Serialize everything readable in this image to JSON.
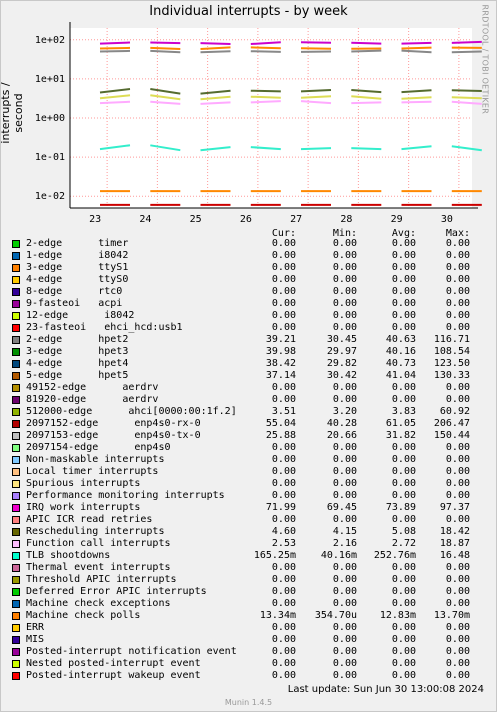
{
  "chart_data": {
    "type": "line",
    "title": "Individual interrupts - by week",
    "ylabel": "interrupts / second",
    "side_label": "RRDTOOL / TOBI OETIKER",
    "y_scale": "log",
    "ylim": [
      0.005,
      200
    ],
    "y_ticks": [
      "1e+02",
      "1e+01",
      "1e+00",
      "1e-01",
      "1e-02"
    ],
    "x_ticks": [
      "23",
      "24",
      "25",
      "26",
      "27",
      "28",
      "29",
      "30"
    ],
    "grid": true,
    "series": [
      {
        "name": "Performance monitoring interrupts / hpet",
        "color": "#cc00cc",
        "values": [
          80,
          85,
          82,
          78,
          86,
          84,
          80,
          83,
          88,
          82,
          79,
          81
        ]
      },
      {
        "name": "hpet5",
        "color": "#ff8800",
        "values": [
          60,
          62,
          58,
          64,
          61,
          59,
          60,
          63,
          62,
          58,
          61,
          60
        ]
      },
      {
        "name": "hpet4",
        "color": "#888888",
        "values": [
          50,
          52,
          48,
          51,
          49,
          50,
          53,
          48,
          50,
          51,
          49,
          52
        ]
      },
      {
        "name": "2097152-edge enp4s0-rx-0",
        "color": "#556b2f",
        "values": [
          4.5,
          5.5,
          4.2,
          5.0,
          4.8,
          5.2,
          4.6,
          5.1,
          4.9,
          5.3,
          4.7,
          4.5
        ]
      },
      {
        "name": "Rescheduling interrupts",
        "color": "#dddd55",
        "values": [
          3.2,
          3.8,
          3.0,
          3.5,
          3.3,
          3.6,
          3.1,
          3.4,
          3.2,
          3.7,
          3.0,
          3.3
        ]
      },
      {
        "name": "Function call interrupts",
        "color": "#ffaaff",
        "values": [
          2.4,
          2.6,
          2.3,
          2.5,
          2.7,
          2.4,
          2.5,
          2.6,
          2.3,
          2.5,
          2.4,
          2.6
        ]
      },
      {
        "name": "TLB shootdowns",
        "color": "#33eecc",
        "values": [
          0.16,
          0.2,
          0.15,
          0.18,
          0.16,
          0.17,
          0.16,
          0.19,
          0.15,
          0.17,
          0.16,
          0.18
        ]
      },
      {
        "name": "Machine check polls",
        "color": "#ff8800",
        "values": [
          0.0135,
          0.0135,
          0.0135,
          0.0135,
          0.0135,
          0.0135,
          0.0135,
          0.0135,
          0.0135,
          0.0135,
          0.0135,
          0.0135
        ]
      },
      {
        "name": "ERR",
        "color": "#cc0000",
        "values": [
          0.006,
          0.006,
          0.006,
          0.006,
          0.006,
          0.006,
          0.006,
          0.006,
          0.006,
          0.006,
          0.006,
          0.006
        ]
      }
    ]
  },
  "legend": {
    "headers": {
      "cur": "Cur:",
      "min": "Min:",
      "avg": "Avg:",
      "max": "Max:"
    },
    "rows": [
      {
        "name": "2-edge      timer",
        "color": "#00cc00",
        "cur": "0.00",
        "min": "0.00",
        "avg": "0.00",
        "max": "0.00"
      },
      {
        "name": "1-edge      i8042",
        "color": "#0066b3",
        "cur": "0.00",
        "min": "0.00",
        "avg": "0.00",
        "max": "0.00"
      },
      {
        "name": "3-edge      ttyS1",
        "color": "#ff8000",
        "cur": "0.00",
        "min": "0.00",
        "avg": "0.00",
        "max": "0.00"
      },
      {
        "name": "4-edge      ttyS0",
        "color": "#ffcc00",
        "cur": "0.00",
        "min": "0.00",
        "avg": "0.00",
        "max": "0.00"
      },
      {
        "name": "8-edge      rtc0",
        "color": "#330099",
        "cur": "0.00",
        "min": "0.00",
        "avg": "0.00",
        "max": "0.00"
      },
      {
        "name": "9-fasteoi   acpi",
        "color": "#990099",
        "cur": "0.00",
        "min": "0.00",
        "avg": "0.00",
        "max": "0.00"
      },
      {
        "name": "12-edge      i8042",
        "color": "#ccff00",
        "cur": "0.00",
        "min": "0.00",
        "avg": "0.00",
        "max": "0.00"
      },
      {
        "name": "23-fasteoi   ehci_hcd:usb1",
        "color": "#ff0000",
        "cur": "0.00",
        "min": "0.00",
        "avg": "0.00",
        "max": "0.00"
      },
      {
        "name": "2-edge      hpet2",
        "color": "#808080",
        "cur": "39.21",
        "min": "30.45",
        "avg": "40.63",
        "max": "116.71"
      },
      {
        "name": "3-edge      hpet3",
        "color": "#008f00",
        "cur": "39.98",
        "min": "29.97",
        "avg": "40.16",
        "max": "108.54"
      },
      {
        "name": "4-edge      hpet4",
        "color": "#00487d",
        "cur": "38.42",
        "min": "29.82",
        "avg": "40.73",
        "max": "123.50"
      },
      {
        "name": "5-edge      hpet5",
        "color": "#b35a00",
        "cur": "37.14",
        "min": "30.42",
        "avg": "41.04",
        "max": "130.33"
      },
      {
        "name": "49152-edge      aerdrv",
        "color": "#b38f00",
        "cur": "0.00",
        "min": "0.00",
        "avg": "0.00",
        "max": "0.00"
      },
      {
        "name": "81920-edge      aerdrv",
        "color": "#6b006b",
        "cur": "0.00",
        "min": "0.00",
        "avg": "0.00",
        "max": "0.00"
      },
      {
        "name": "512000-edge      ahci[0000:00:1f.2]",
        "color": "#8fb300",
        "cur": "3.51",
        "min": "3.20",
        "avg": "3.83",
        "max": "60.92"
      },
      {
        "name": "2097152-edge      enp4s0-rx-0",
        "color": "#b30000",
        "cur": "55.04",
        "min": "40.28",
        "avg": "61.05",
        "max": "206.47"
      },
      {
        "name": "2097153-edge      enp4s0-tx-0",
        "color": "#bebebe",
        "cur": "25.88",
        "min": "20.66",
        "avg": "31.82",
        "max": "150.44"
      },
      {
        "name": "2097154-edge      enp4s0",
        "color": "#80ff80",
        "cur": "0.00",
        "min": "0.00",
        "avg": "0.00",
        "max": "0.00"
      },
      {
        "name": "Non-maskable interrupts",
        "color": "#80c9ff",
        "cur": "0.00",
        "min": "0.00",
        "avg": "0.00",
        "max": "0.00"
      },
      {
        "name": "Local timer interrupts",
        "color": "#ffc080",
        "cur": "0.00",
        "min": "0.00",
        "avg": "0.00",
        "max": "0.00"
      },
      {
        "name": "Spurious interrupts",
        "color": "#ffe680",
        "cur": "0.00",
        "min": "0.00",
        "avg": "0.00",
        "max": "0.00"
      },
      {
        "name": "Performance monitoring interrupts",
        "color": "#aa80ff",
        "cur": "0.00",
        "min": "0.00",
        "avg": "0.00",
        "max": "0.00"
      },
      {
        "name": "IRQ work interrupts",
        "color": "#ee00cc",
        "cur": "71.99",
        "min": "69.45",
        "avg": "73.89",
        "max": "97.37"
      },
      {
        "name": "APIC ICR read retries",
        "color": "#ff8080",
        "cur": "0.00",
        "min": "0.00",
        "avg": "0.00",
        "max": "0.00"
      },
      {
        "name": "Rescheduling interrupts",
        "color": "#666600",
        "cur": "4.60",
        "min": "4.15",
        "avg": "5.08",
        "max": "18.42"
      },
      {
        "name": "Function call interrupts",
        "color": "#ffbfff",
        "cur": "2.53",
        "min": "2.16",
        "avg": "2.72",
        "max": "18.87"
      },
      {
        "name": "TLB shootdowns",
        "color": "#00ffcc",
        "cur": "165.25m",
        "min": "40.16m",
        "avg": "252.76m",
        "max": "16.48"
      },
      {
        "name": "Thermal event interrupts",
        "color": "#cc6699",
        "cur": "0.00",
        "min": "0.00",
        "avg": "0.00",
        "max": "0.00"
      },
      {
        "name": "Threshold APIC interrupts",
        "color": "#999900",
        "cur": "0.00",
        "min": "0.00",
        "avg": "0.00",
        "max": "0.00"
      },
      {
        "name": "Deferred Error APIC interrupts",
        "color": "#00cc00",
        "cur": "0.00",
        "min": "0.00",
        "avg": "0.00",
        "max": "0.00"
      },
      {
        "name": "Machine check exceptions",
        "color": "#0066b3",
        "cur": "0.00",
        "min": "0.00",
        "avg": "0.00",
        "max": "0.00"
      },
      {
        "name": "Machine check polls",
        "color": "#ff8000",
        "cur": "13.34m",
        "min": "354.70u",
        "avg": "12.83m",
        "max": "13.70m"
      },
      {
        "name": "ERR",
        "color": "#ffcc00",
        "cur": "0.00",
        "min": "0.00",
        "avg": "0.00",
        "max": "0.00"
      },
      {
        "name": "MIS",
        "color": "#330099",
        "cur": "0.00",
        "min": "0.00",
        "avg": "0.00",
        "max": "0.00"
      },
      {
        "name": "Posted-interrupt notification event",
        "color": "#990099",
        "cur": "0.00",
        "min": "0.00",
        "avg": "0.00",
        "max": "0.00"
      },
      {
        "name": "Nested posted-interrupt event",
        "color": "#ccff00",
        "cur": "0.00",
        "min": "0.00",
        "avg": "0.00",
        "max": "0.00"
      },
      {
        "name": "Posted-interrupt wakeup event",
        "color": "#ff0000",
        "cur": "0.00",
        "min": "0.00",
        "avg": "0.00",
        "max": "0.00"
      }
    ]
  },
  "footer": {
    "last_update": "Last update:  Sun Jun 30 13:00:08 2024",
    "version": "Munin 1.4.5"
  }
}
